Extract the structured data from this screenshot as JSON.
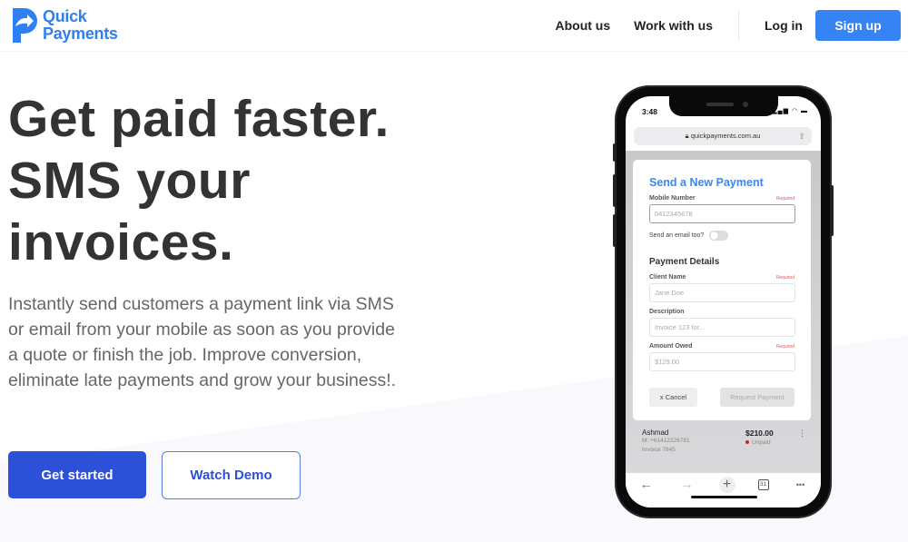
{
  "brand": {
    "line1": "Quick",
    "line2": "Payments",
    "color": "#2f7ff0",
    "icon": "logo-p-arrow-icon"
  },
  "nav": {
    "about": "About us",
    "work": "Work with us",
    "login": "Log in",
    "signup": "Sign up",
    "signup_color": "#3683f3"
  },
  "hero": {
    "headline_lines": [
      "Get paid faster.",
      "SMS your",
      "invoices."
    ],
    "description": "Instantly send customers a payment link via SMS or email from your mobile as soon as you provide a quote or finish the job. Improve conversion, eliminate late payments and grow your business!.",
    "primary_cta": "Get started",
    "secondary_cta": "Watch Demo",
    "accent_color": "#2d50d8"
  },
  "phone": {
    "status_time": "3:48",
    "status_icons": "signal wifi battery",
    "url": "quickpayments.com.au",
    "modal": {
      "title": "Send a New Payment",
      "mobile_label": "Mobile Number",
      "mobile_required": "Required",
      "mobile_placeholder": "0412345678",
      "email_toggle_label": "Send an email too?",
      "email_toggle_on": false,
      "section_title": "Payment Details",
      "client_label": "Client Name",
      "client_required": "Required",
      "client_placeholder": "Jane Doe",
      "description_label": "Description",
      "description_placeholder": "Invoice 123 for...",
      "amount_label": "Amount Owed",
      "amount_required": "Required",
      "amount_placeholder": "$129.00",
      "cancel": "x Cancel",
      "request": "Request Payment"
    },
    "list_item": {
      "name": "Ashmad",
      "mobile": "M: +61412226781",
      "invoice": "Invoice 7845",
      "amount": "$210.00",
      "status": "Unpaid"
    },
    "toolbar": {
      "back": "←",
      "forward": "→",
      "new_tab": "+",
      "tabs_count": "31",
      "more": "•••"
    }
  }
}
